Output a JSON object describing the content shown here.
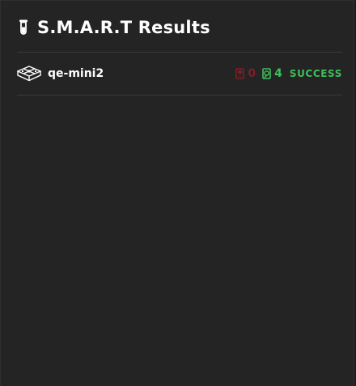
{
  "widget": {
    "title": "S.M.A.R.T Results",
    "title_icon": "test-tube-icon"
  },
  "servers": [
    {
      "name": "qe-mini2",
      "icon": "server-grid-icon",
      "failed_count": "0",
      "failed_icon": "disk-error-icon",
      "passed_count": "4",
      "passed_icon": "disk-ok-icon",
      "status": "SUCCESS"
    }
  ],
  "colors": {
    "panel_bg": "#242424",
    "fail": "#7d1f27",
    "success": "#3fbf5a"
  }
}
